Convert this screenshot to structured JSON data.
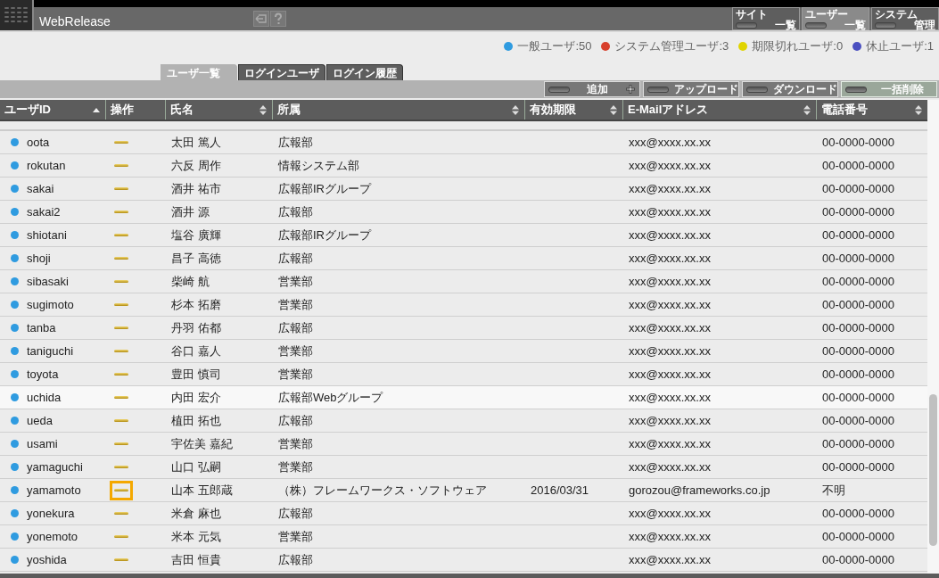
{
  "app": {
    "title": "WebRelease"
  },
  "nav": [
    {
      "label": "サイト",
      "sublabel": "一覧",
      "selected": false
    },
    {
      "label": "ユーザー",
      "sublabel": "一覧",
      "selected": true
    },
    {
      "label": "システム",
      "sublabel": "管理",
      "selected": false
    }
  ],
  "legend": [
    {
      "label": "一般ユーザ:50",
      "color": "#2f9be0"
    },
    {
      "label": "システム管理ユーザ:3",
      "color": "#d8402c"
    },
    {
      "label": "期限切れユーザ:0",
      "color": "#e0d400"
    },
    {
      "label": "休止ユーザ:1",
      "color": "#4a4fc0"
    }
  ],
  "tabs": [
    {
      "label": "ユーザ一覧",
      "selected": true
    },
    {
      "label": "ログインユーザ",
      "selected": false
    },
    {
      "label": "ログイン履歴",
      "selected": false
    }
  ],
  "actions": [
    {
      "label": "追加",
      "kind": "add",
      "highlighted": false
    },
    {
      "label": "アップロード",
      "kind": "plain",
      "highlighted": false
    },
    {
      "label": "ダウンロード",
      "kind": "plain",
      "highlighted": false
    },
    {
      "label": "一括削除",
      "kind": "plain",
      "highlighted": true
    }
  ],
  "table": {
    "columns": [
      {
        "label": "ユーザID",
        "sorted": true
      },
      {
        "label": "操作"
      },
      {
        "label": "氏名",
        "sorted": false
      },
      {
        "label": "所属",
        "sorted": false
      },
      {
        "label": "有効期限",
        "sorted": false
      },
      {
        "label": "E-Mailアドレス",
        "sorted": false
      },
      {
        "label": "電話番号",
        "sorted": false
      }
    ],
    "rows": [
      {
        "id": "oota",
        "color": "#2f9be0",
        "name": "太田 篤人",
        "dept": "広報部",
        "email": "xxx@xxxx.xx.xx",
        "phone": "00-0000-0000",
        "focused": false,
        "hovered": false
      },
      {
        "id": "rokutan",
        "color": "#2f9be0",
        "name": "六反 周作",
        "dept": "情報システム部",
        "email": "xxx@xxxx.xx.xx",
        "phone": "00-0000-0000",
        "focused": false,
        "hovered": false
      },
      {
        "id": "sakai",
        "color": "#2f9be0",
        "name": "酒井 祐市",
        "dept": "広報部IRグループ",
        "email": "xxx@xxxx.xx.xx",
        "phone": "00-0000-0000",
        "focused": false,
        "hovered": false
      },
      {
        "id": "sakai2",
        "color": "#2f9be0",
        "name": "酒井 源",
        "dept": "広報部",
        "email": "xxx@xxxx.xx.xx",
        "phone": "00-0000-0000",
        "focused": false,
        "hovered": false
      },
      {
        "id": "shiotani",
        "color": "#2f9be0",
        "name": "塩谷 廣輝",
        "dept": "広報部IRグループ",
        "email": "xxx@xxxx.xx.xx",
        "phone": "00-0000-0000",
        "focused": false,
        "hovered": false
      },
      {
        "id": "shoji",
        "color": "#2f9be0",
        "name": "昌子 高徳",
        "dept": "広報部",
        "email": "xxx@xxxx.xx.xx",
        "phone": "00-0000-0000",
        "focused": false,
        "hovered": false
      },
      {
        "id": "sibasaki",
        "color": "#2f9be0",
        "name": "柴崎 航",
        "dept": "営業部",
        "email": "xxx@xxxx.xx.xx",
        "phone": "00-0000-0000",
        "focused": false,
        "hovered": false
      },
      {
        "id": "sugimoto",
        "color": "#2f9be0",
        "name": "杉本 拓磨",
        "dept": "営業部",
        "email": "xxx@xxxx.xx.xx",
        "phone": "00-0000-0000",
        "focused": false,
        "hovered": false
      },
      {
        "id": "tanba",
        "color": "#2f9be0",
        "name": "丹羽 佑都",
        "dept": "広報部",
        "email": "xxx@xxxx.xx.xx",
        "phone": "00-0000-0000",
        "focused": false,
        "hovered": false
      },
      {
        "id": "taniguchi",
        "color": "#2f9be0",
        "name": "谷口 嘉人",
        "dept": "営業部",
        "email": "xxx@xxxx.xx.xx",
        "phone": "00-0000-0000",
        "focused": false,
        "hovered": false
      },
      {
        "id": "toyota",
        "color": "#2f9be0",
        "name": "豊田 慎司",
        "dept": "営業部",
        "email": "xxx@xxxx.xx.xx",
        "phone": "00-0000-0000",
        "focused": false,
        "hovered": false
      },
      {
        "id": "uchida",
        "color": "#2f9be0",
        "name": "内田 宏介",
        "dept": "広報部Webグループ",
        "email": "xxx@xxxx.xx.xx",
        "phone": "00-0000-0000",
        "focused": false,
        "hovered": true
      },
      {
        "id": "ueda",
        "color": "#2f9be0",
        "name": "植田 拓也",
        "dept": "広報部",
        "email": "xxx@xxxx.xx.xx",
        "phone": "00-0000-0000",
        "focused": false,
        "hovered": false
      },
      {
        "id": "usami",
        "color": "#2f9be0",
        "name": "宇佐美 嘉紀",
        "dept": "営業部",
        "email": "xxx@xxxx.xx.xx",
        "phone": "00-0000-0000",
        "focused": false,
        "hovered": false
      },
      {
        "id": "yamaguchi",
        "color": "#2f9be0",
        "name": "山口 弘嗣",
        "dept": "営業部",
        "email": "xxx@xxxx.xx.xx",
        "phone": "00-0000-0000",
        "focused": false,
        "hovered": false
      },
      {
        "id": "yamamoto",
        "color": "#2f9be0",
        "name": "山本 五郎蔵",
        "dept": "（株）フレームワークス・ソフトウェア",
        "expires": "2016/03/31",
        "email": "gorozou@frameworks.co.jp",
        "phone": "不明",
        "focused": true,
        "hovered": false
      },
      {
        "id": "yonekura",
        "color": "#2f9be0",
        "name": "米倉 麻也",
        "dept": "広報部",
        "email": "xxx@xxxx.xx.xx",
        "phone": "00-0000-0000",
        "focused": false,
        "hovered": false
      },
      {
        "id": "yonemoto",
        "color": "#2f9be0",
        "name": "米本 元気",
        "dept": "営業部",
        "email": "xxx@xxxx.xx.xx",
        "phone": "00-0000-0000",
        "focused": false,
        "hovered": false
      },
      {
        "id": "yoshida",
        "color": "#2f9be0",
        "name": "吉田 恒貴",
        "dept": "広報部",
        "email": "xxx@xxxx.xx.xx",
        "phone": "00-0000-0000",
        "focused": false,
        "hovered": false
      }
    ]
  }
}
